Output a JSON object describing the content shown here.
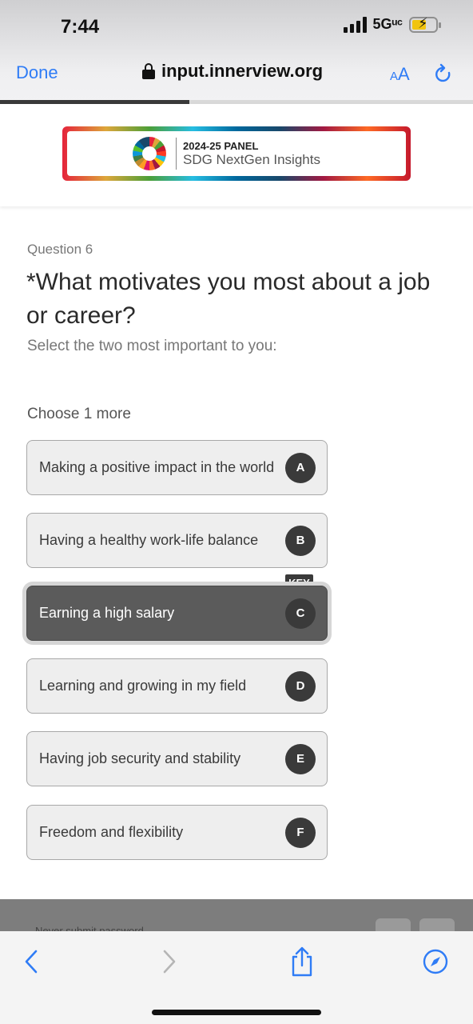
{
  "status_bar": {
    "time": "7:44",
    "network": "5Gᵘᶜ",
    "battery_level": 0.6
  },
  "browser": {
    "done_label": "Done",
    "url": "input.innerview.org",
    "text_size_label": "AA",
    "page_load_progress": 0.4
  },
  "banner": {
    "line1": "2024-25 PANEL",
    "line2": "SDG NextGen Insights"
  },
  "question": {
    "number_label": "Question 6",
    "title": "*What  motivates you most about a job or career?",
    "subtitle": "Select the two most important to you:",
    "choose_hint": "Choose 1 more",
    "key_badge": "KEY",
    "options": [
      {
        "label": "Making a positive impact in the world",
        "key": "A",
        "selected": false
      },
      {
        "label": "Having a healthy work-life balance",
        "key": "B",
        "selected": false
      },
      {
        "label": "Earning a high salary",
        "key": "C",
        "selected": true
      },
      {
        "label": "Learning and growing in my field",
        "key": "D",
        "selected": false
      },
      {
        "label": "Having job security and stability",
        "key": "E",
        "selected": false
      },
      {
        "label": "Freedom and flexibility",
        "key": "F",
        "selected": false
      }
    ]
  },
  "toolbar": {
    "autofill_text": "Never submit password"
  },
  "colors": {
    "accent": "#2f7cf6",
    "option_bg": "#eeeeee",
    "selected_bg": "#5b5b5b"
  }
}
